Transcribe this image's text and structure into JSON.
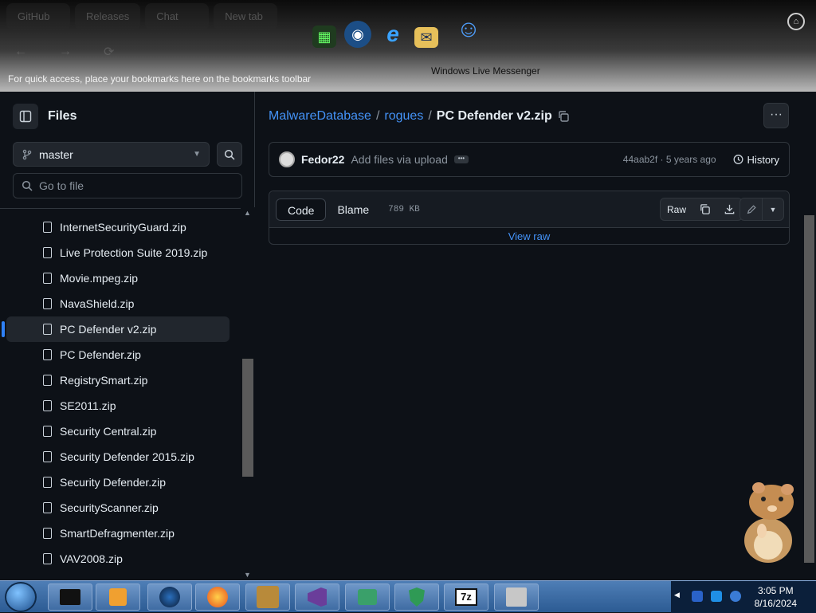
{
  "browser": {
    "tabs": [
      "GitHub",
      "Releases",
      "Chat",
      "New tab"
    ],
    "bookmarks_hint": "For quick access, place your bookmarks here on the bookmarks toolbar"
  },
  "dock": {
    "items": [
      "matrix-app-icon",
      "network-app-icon",
      "internet-explorer-icon",
      "outlook-express-icon",
      "windows-live-messenger-icon"
    ],
    "hover_label": "Windows Live Messenger"
  },
  "sidebar": {
    "title": "Files",
    "branch": "master",
    "goto_placeholder": "Go to file",
    "files": [
      "InternetSecurityGuard.zip",
      "Live Protection Suite 2019.zip",
      "Movie.mpeg.zip",
      "NavaShield.zip",
      "PC Defender v2.zip",
      "PC Defender.zip",
      "RegistrySmart.zip",
      "SE2011.zip",
      "Security Central.zip",
      "Security Defender 2015.zip",
      "Security Defender.zip",
      "SecurityScanner.zip",
      "SmartDefragmenter.zip",
      "VAV2008.zip"
    ],
    "active_file_index": 4
  },
  "main": {
    "breadcrumb": {
      "repo": "MalwareDatabase",
      "folder": "rogues",
      "file": "PC Defender v2.zip",
      "sep": "/"
    },
    "commit": {
      "author": "Fedor22",
      "message": "Add files via upload",
      "meta": "44aab2f · 5 years ago",
      "history": "History"
    },
    "code": {
      "tab_code": "Code",
      "tab_blame": "Blame",
      "size": "789 KB",
      "raw": "Raw",
      "view_raw": "View raw"
    }
  },
  "taskbar": {
    "apps": [
      "terminal-icon",
      "media-player-icon",
      "globe-icon",
      "firefox-icon",
      "game-icon",
      "visual-studio-icon",
      "app-icon",
      "shield-icon",
      "7zip-icon",
      "installer-icon"
    ],
    "time": "3:05 PM",
    "date": "8/16/2024"
  }
}
